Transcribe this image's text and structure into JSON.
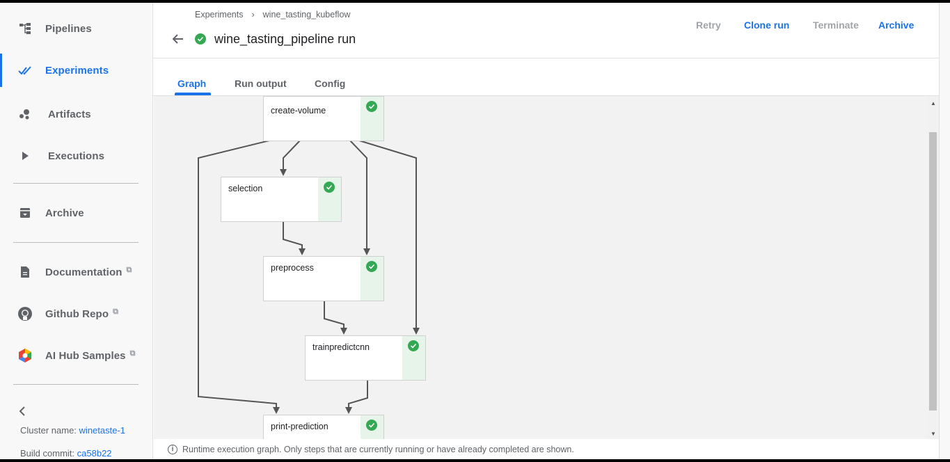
{
  "sidebar": {
    "items": [
      {
        "label": "Pipelines",
        "icon": "pipelines-icon"
      },
      {
        "label": "Experiments",
        "icon": "experiments-icon",
        "active": true
      },
      {
        "label": "Artifacts",
        "icon": "artifacts-icon"
      },
      {
        "label": "Executions",
        "icon": "executions-icon"
      },
      {
        "label": "Archive",
        "icon": "archive-icon"
      },
      {
        "label": "Documentation",
        "icon": "document-icon"
      },
      {
        "label": "Github Repo",
        "icon": "github-icon"
      },
      {
        "label": "AI Hub Samples",
        "icon": "ai-hub-icon"
      }
    ],
    "cluster_label": "Cluster name:",
    "cluster_value": "winetaste-1",
    "build_label": "Build commit:",
    "build_value": "ca58b22"
  },
  "header": {
    "breadcrumb": [
      "Experiments",
      "wine_tasting_kubeflow"
    ],
    "breadcrumb_sep": "›",
    "title": "wine_tasting_pipeline run",
    "actions": {
      "retry": "Retry",
      "clone": "Clone run",
      "terminate": "Terminate",
      "archive": "Archive"
    }
  },
  "tabs": [
    "Graph",
    "Run output",
    "Config"
  ],
  "graph": {
    "nodes": [
      {
        "label": "create-volume",
        "status": "succeeded"
      },
      {
        "label": "selection",
        "status": "succeeded"
      },
      {
        "label": "preprocess",
        "status": "succeeded"
      },
      {
        "label": "trainpredictcnn",
        "status": "succeeded"
      },
      {
        "label": "print-prediction",
        "status": "succeeded"
      }
    ]
  },
  "footer_note": "Runtime execution graph. Only steps that are currently running or have already completed are shown.",
  "colors": {
    "accent": "#1a73e8",
    "success": "#34a853",
    "success_bg": "#e6f4ea"
  }
}
